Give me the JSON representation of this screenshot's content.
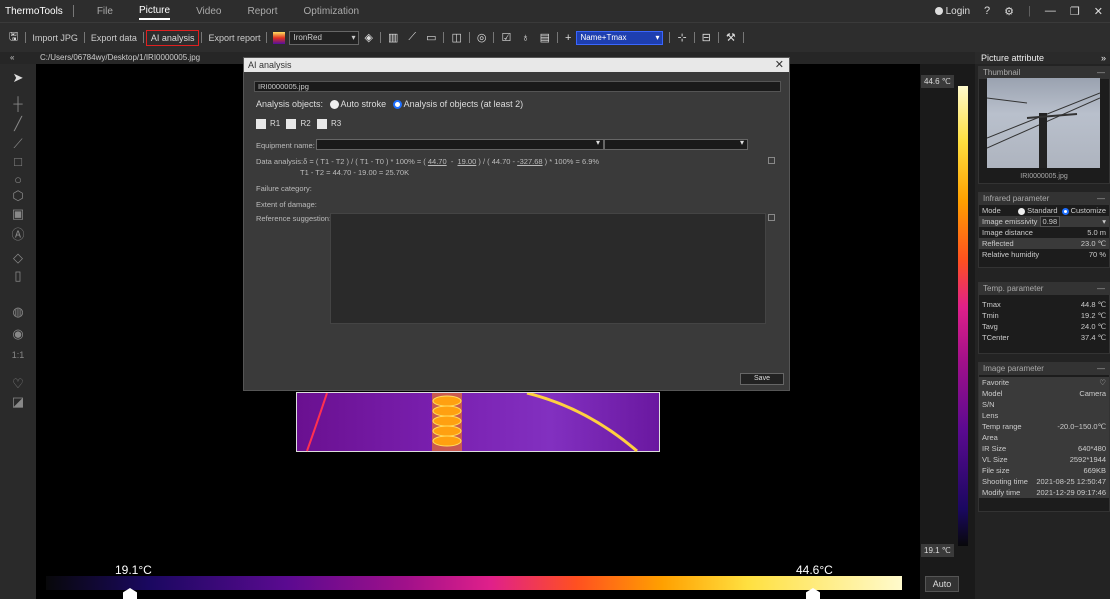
{
  "app": {
    "name": "ThermoTools"
  },
  "menu": {
    "items": [
      "File",
      "Picture",
      "Video",
      "Report",
      "Optimization"
    ],
    "active": "Picture"
  },
  "titlebar": {
    "login": "Login"
  },
  "toolbar": {
    "import_jpg": "Import JPG",
    "export_data": "Export data",
    "ai_analysis": "AI analysis",
    "export_report": "Export report",
    "palette": "IronRed",
    "label_mode": "Name+Tmax"
  },
  "path": "C:/Users/06784wy/Desktop/1/IRI0000005.jpg",
  "left_tools": {
    "ratio": "1:1"
  },
  "dialog": {
    "title": "AI analysis",
    "file": "IRI0000005.jpg",
    "analysis_objects_label": "Analysis objects:",
    "opt_auto": "Auto stroke",
    "opt_objects": "Analysis of objects (at least 2)",
    "regions": [
      "R1",
      "R2",
      "R3"
    ],
    "equipment_label": "Equipment name:",
    "data_analysis_prefix": "Data analysis:δ = ( T1 - T2 ) / ( T1 - T0 ) * 100% = ( ",
    "v1": "44.70",
    "v2": "19.00",
    "mid": " ) / ( 44.70 - ",
    "v3": "-327.68",
    "suffix": " ) * 100% = 6.9%",
    "line2": "T1 - T2 = 44.70 - 19.00 = 25.70K",
    "failure_label": "Failure category:",
    "extent_label": "Extent of damage:",
    "reference_label": "Reference suggestion:",
    "save": "Save"
  },
  "scale": {
    "max": "44.6 ℃",
    "min": "19.1 ℃",
    "auto": "Auto"
  },
  "colorbar": {
    "min": "19.1°C",
    "max": "44.6°C"
  },
  "panel": {
    "title": "Picture attribute",
    "thumbnail": {
      "head": "Thumbnail",
      "caption": "IRI0000005.jpg"
    },
    "infrared": {
      "head": "Infrared parameter",
      "mode_label": "Mode",
      "mode_standard": "Standard",
      "mode_custom": "Customize",
      "rows": [
        {
          "k": "Image emissivity",
          "v": "0.98"
        },
        {
          "k": "Image distance",
          "v": "5.0 m"
        },
        {
          "k": "Reflected",
          "v": "23.0 ℃"
        },
        {
          "k": "Relative humidity",
          "v": "70 %"
        }
      ]
    },
    "temp": {
      "head": "Temp. parameter",
      "rows": [
        {
          "k": "Tmax",
          "v": "44.8 ℃"
        },
        {
          "k": "Tmin",
          "v": "19.2 ℃"
        },
        {
          "k": "Tavg",
          "v": "24.0 ℃"
        },
        {
          "k": "TCenter",
          "v": "37.4 ℃"
        }
      ]
    },
    "image": {
      "head": "Image parameter",
      "rows": [
        {
          "k": "Favorite",
          "v": "♡"
        },
        {
          "k": "Model",
          "v": "Camera"
        },
        {
          "k": "S/N",
          "v": ""
        },
        {
          "k": "Lens",
          "v": ""
        },
        {
          "k": "Temp range",
          "v": "-20.0~150.0℃"
        },
        {
          "k": "Area",
          "v": ""
        },
        {
          "k": "IR Size",
          "v": "640*480"
        },
        {
          "k": "VL Size",
          "v": "2592*1944"
        },
        {
          "k": "File size",
          "v": "669KB"
        },
        {
          "k": "Shooting time",
          "v": "2021-08-25 12:50:47"
        },
        {
          "k": "Modify time",
          "v": "2021-12-29 09:17:46"
        }
      ]
    }
  }
}
